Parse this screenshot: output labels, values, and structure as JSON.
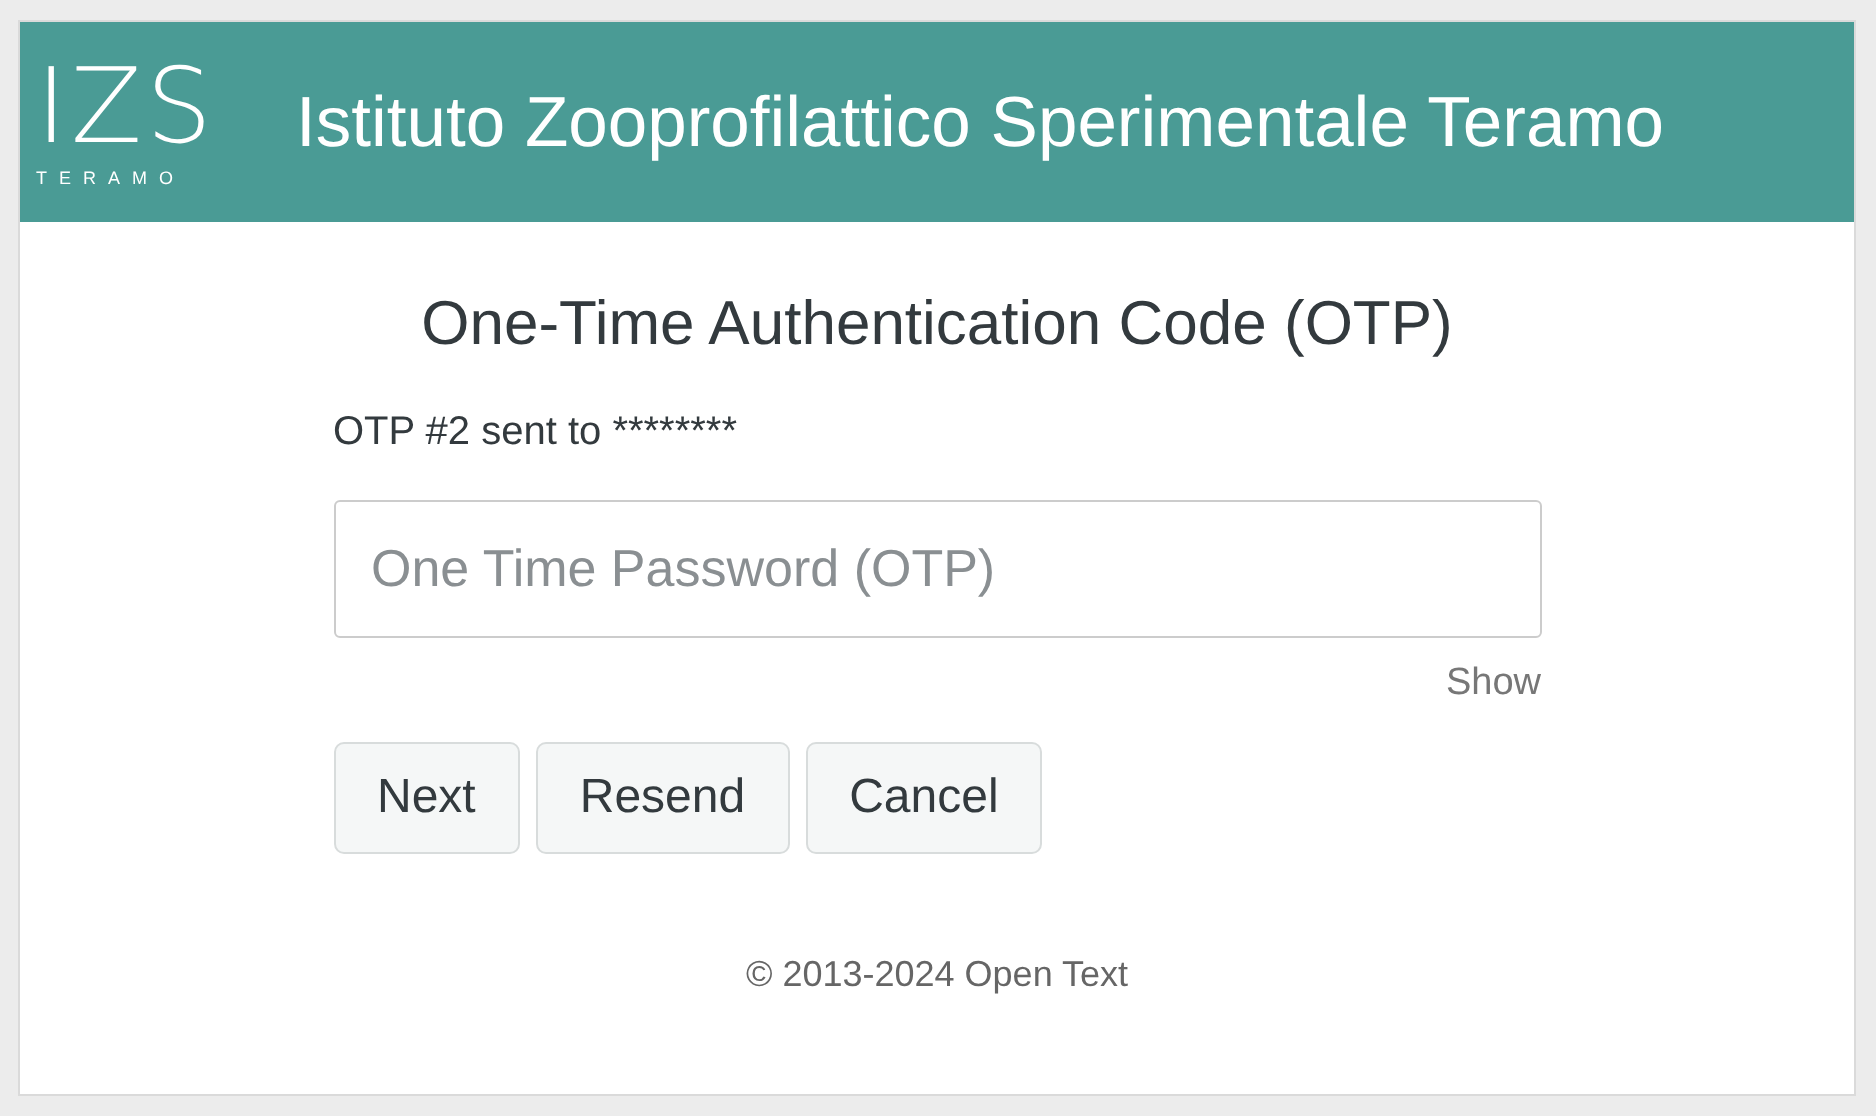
{
  "header": {
    "logo": {
      "mark": "IZS",
      "caption": "TERAMO"
    },
    "title": "Istituto Zooprofilattico Sperimentale Teramo"
  },
  "form": {
    "heading": "One-Time Authentication Code (OTP)",
    "info": "OTP #2 sent to ********",
    "otp_field": {
      "placeholder": "One Time Password (OTP)"
    },
    "show_link": "Show",
    "buttons": [
      {
        "label": "Next"
      },
      {
        "label": "Resend"
      },
      {
        "label": "Cancel"
      }
    ]
  },
  "footer": "© 2013-2024 Open Text"
}
